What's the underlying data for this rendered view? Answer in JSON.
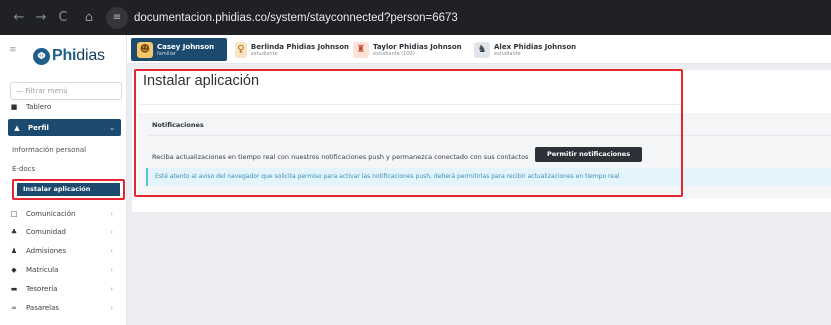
{
  "browser": {
    "back_icon": "←",
    "forward_icon": "→",
    "reload_icon": "C",
    "home_icon": "⌂",
    "site_info_icon": "≡",
    "url": "documentacion.phidias.co/system/stayconnected?person=6673"
  },
  "sidebar": {
    "toggle_icon": "≡",
    "logo_mark": "Φ",
    "logo_prefix": "Phi",
    "logo_suffix": "dias",
    "filter_placeholder": "— Filtrar menú",
    "items": [
      {
        "label": "Tablero",
        "icon": "■"
      },
      {
        "label": "Perfil",
        "icon": "▲",
        "chevron": "⌄"
      },
      {
        "label": "Comunicación",
        "icon": "□",
        "chevron": "›"
      },
      {
        "label": "Comunidad",
        "icon": "♣",
        "chevron": "›"
      },
      {
        "label": "Admisiones",
        "icon": "♟",
        "chevron": "›"
      },
      {
        "label": "Matrícula",
        "icon": "◆",
        "chevron": "›"
      },
      {
        "label": "Tesorería",
        "icon": "▬",
        "chevron": "›"
      },
      {
        "label": "Pasarelas",
        "icon": "∞",
        "chevron": "›"
      }
    ],
    "sub_items": [
      "Información personal",
      "E-docs",
      "Instalar aplicación"
    ]
  },
  "tabs": [
    {
      "name": "Casey Johnson",
      "role": "familiar",
      "icon": "☻"
    },
    {
      "name": "Berlinda Phidias Johnson",
      "role": "estudiante",
      "icon": "♀"
    },
    {
      "name": "Taylor Phidias Johnson",
      "role": "estudiante (100)",
      "icon": "♜"
    },
    {
      "name": "Alex Phidias Johnson",
      "role": "estudiante",
      "icon": "♞"
    }
  ],
  "main": {
    "title": "Instalar aplicación",
    "section_label": "Notificaciones",
    "notification_text": "Reciba actualizaciones en tiempo real con nuestros notificaciones push y permanezca conectado con sus contactos",
    "permit_button": "Permitir notificaciones",
    "info_text": "Esté atento al aviso del navegador que solicita permiso para activar las notificaciones push, deberá permitirlas para recibir actualizaciones en tiempo real"
  },
  "colors": {
    "primary": "#1b4a6e",
    "highlight": "#e3262f",
    "info_bg": "#e3f4fb",
    "info_text": "#3d8fb3",
    "button_dark": "#2d3238"
  }
}
